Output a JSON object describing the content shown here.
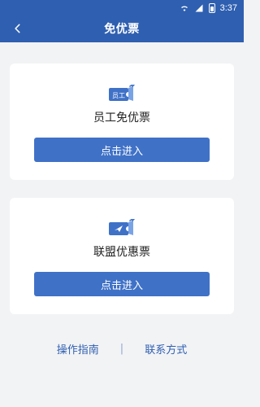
{
  "status": {
    "time": "3:37",
    "battery_level": "8"
  },
  "header": {
    "title": "免优票"
  },
  "cards": [
    {
      "icon_text": "员工",
      "title": "员工免优票",
      "button_label": "点击进入"
    },
    {
      "icon_text": "",
      "title": "联盟优惠票",
      "button_label": "点击进入"
    }
  ],
  "links": {
    "guide": "操作指南",
    "separator": "|",
    "contact": "联系方式"
  },
  "colors": {
    "primary": "#2f5fb0",
    "button": "#3f71c7",
    "background": "#f2f3f5"
  }
}
